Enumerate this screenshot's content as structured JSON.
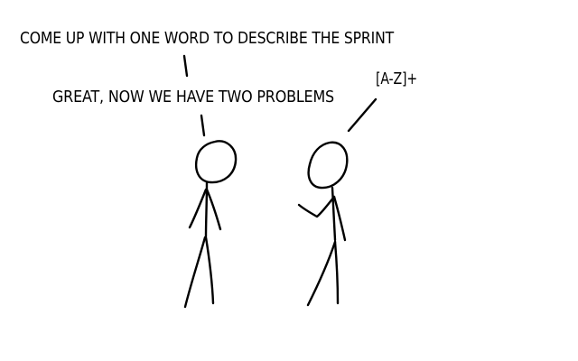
{
  "panel": {
    "line_1": "COME UP WITH ONE WORD TO DESCRIBE THE SPRINT",
    "line_2": "GREAT, NOW WE HAVE TWO PROBLEMS",
    "reply": "[A-Z]+"
  },
  "colors": {
    "background": "#ffffff",
    "ink": "#000000"
  }
}
